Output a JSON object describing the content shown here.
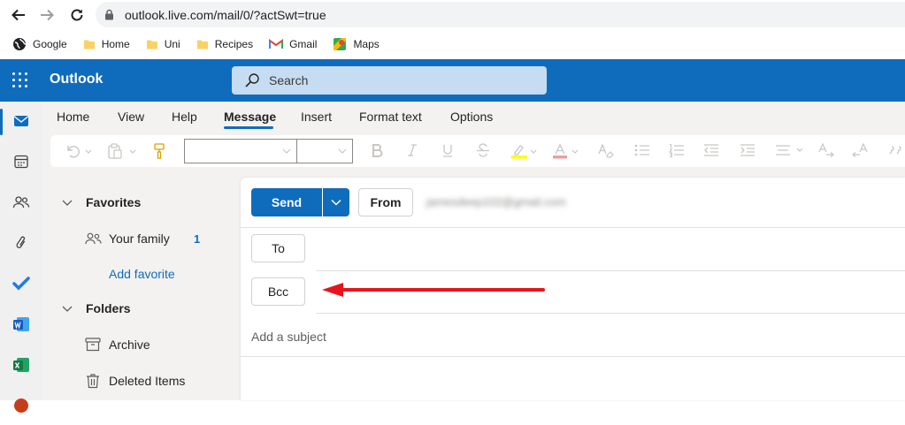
{
  "browser": {
    "url": "outlook.live.com/mail/0/?actSwt=true",
    "bookmarks": [
      {
        "label": "Google",
        "icon": "google-globe-icon"
      },
      {
        "label": "Home",
        "icon": "folder-icon"
      },
      {
        "label": "Uni",
        "icon": "folder-icon"
      },
      {
        "label": "Recipes",
        "icon": "folder-icon"
      },
      {
        "label": "Gmail",
        "icon": "gmail-icon"
      },
      {
        "label": "Maps",
        "icon": "maps-icon"
      }
    ]
  },
  "app": {
    "brand": "Outlook",
    "accent": "#0f6cbd",
    "search_placeholder": "Search"
  },
  "ribbon": {
    "tabs": [
      "Home",
      "View",
      "Help",
      "Message",
      "Insert",
      "Format text",
      "Options"
    ],
    "active_tab": "Message",
    "font_name": "",
    "font_size": ""
  },
  "folders": {
    "favorites_label": "Favorites",
    "your_family_label": "Your family",
    "your_family_count": "1",
    "add_favorite_label": "Add favorite",
    "folders_label": "Folders",
    "archive_label": "Archive",
    "deleted_label": "Deleted Items"
  },
  "compose": {
    "send_label": "Send",
    "from_label": "From",
    "from_email": "jamesdeep102@gmail.com",
    "to_label": "To",
    "bcc_label": "Bcc",
    "subject_placeholder": "Add a subject",
    "annotation_arrow_color": "#e8141b"
  }
}
